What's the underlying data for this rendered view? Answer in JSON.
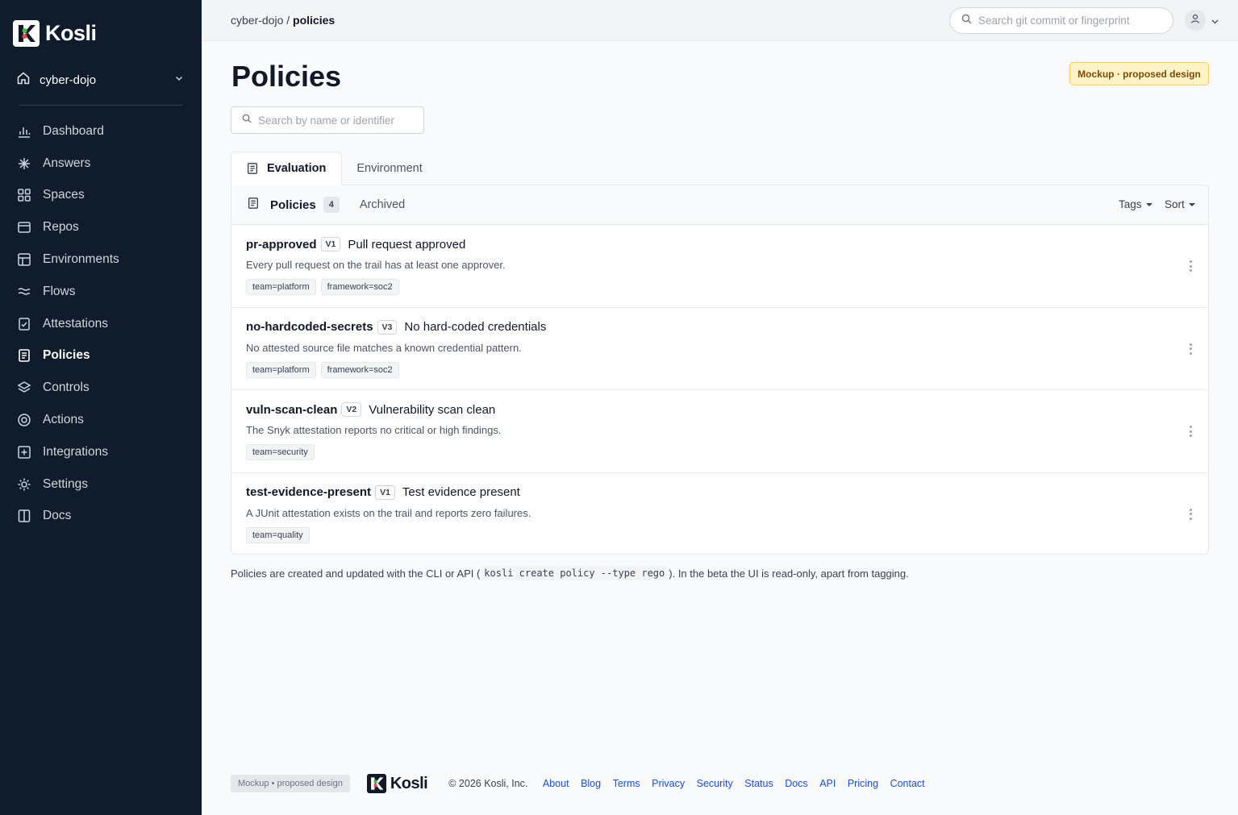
{
  "brand": {
    "name": "Kosli"
  },
  "org": {
    "name": "cyber-dojo"
  },
  "sidebar": {
    "items": [
      {
        "label": "Dashboard",
        "icon": "bar-chart-icon"
      },
      {
        "label": "Answers",
        "icon": "asterisk-icon"
      },
      {
        "label": "Spaces",
        "icon": "grid-icon"
      },
      {
        "label": "Repos",
        "icon": "repo-icon"
      },
      {
        "label": "Environments",
        "icon": "layout-icon"
      },
      {
        "label": "Flows",
        "icon": "waves-icon"
      },
      {
        "label": "Attestations",
        "icon": "check-square-icon"
      },
      {
        "label": "Policies",
        "icon": "document-icon",
        "active": true
      },
      {
        "label": "Controls",
        "icon": "layers-icon"
      },
      {
        "label": "Actions",
        "icon": "target-icon"
      },
      {
        "label": "Integrations",
        "icon": "plus-square-icon"
      },
      {
        "label": "Settings",
        "icon": "sun-gear-icon"
      },
      {
        "label": "Docs",
        "icon": "book-icon"
      }
    ]
  },
  "topbar": {
    "breadcrumb_parent": "cyber-dojo",
    "breadcrumb_sep": " / ",
    "breadcrumb_current": "policies",
    "search_placeholder": "Search git commit or fingerprint"
  },
  "main": {
    "title": "Policies",
    "mock_badge": "Mockup · proposed design",
    "search_placeholder": "Search by name or identifier",
    "tabs": [
      {
        "label": "Evaluation",
        "active": true
      },
      {
        "label": "Environment"
      }
    ],
    "panel": {
      "title": "Policies",
      "count": "4",
      "archived": "Archived",
      "tags_label": "Tags",
      "sort_label": "Sort"
    },
    "policies": [
      {
        "id": "pr-approved",
        "version": "V1",
        "name": "Pull request approved",
        "description": "Every pull request on the trail has at least one approver.",
        "tags": [
          "team=platform",
          "framework=soc2"
        ]
      },
      {
        "id": "no-hardcoded-secrets",
        "version": "V3",
        "name": "No hard-coded credentials",
        "description": "No attested source file matches a known credential pattern.",
        "tags": [
          "team=platform",
          "framework=soc2"
        ]
      },
      {
        "id": "vuln-scan-clean",
        "version": "V2",
        "name": "Vulnerability scan clean",
        "description": "The Snyk attestation reports no critical or high findings.",
        "tags": [
          "team=security"
        ]
      },
      {
        "id": "test-evidence-present",
        "version": "V1",
        "name": "Test evidence present",
        "description": "A JUnit attestation exists on the trail and reports zero failures.",
        "tags": [
          "team=quality"
        ]
      }
    ],
    "footnote": {
      "before": "Policies are created and updated with the CLI or API (",
      "code": "kosli create policy --type rego",
      "after": "). In the beta the UI is read-only, apart from tagging."
    }
  },
  "footer": {
    "badge": "Mockup • proposed design",
    "logo_text": "Kosli",
    "copyright": "© 2026 Kosli, Inc.",
    "links": [
      "About",
      "Blog",
      "Terms",
      "Privacy",
      "Security",
      "Status",
      "Docs",
      "API",
      "Pricing",
      "Contact"
    ]
  },
  "colors": {
    "sidebar_bg": "#101b2b",
    "accent_link": "#1d4ed8",
    "logo_green": "#3fb950",
    "logo_red": "#e5484d",
    "badge_bg": "#fef3c7"
  }
}
